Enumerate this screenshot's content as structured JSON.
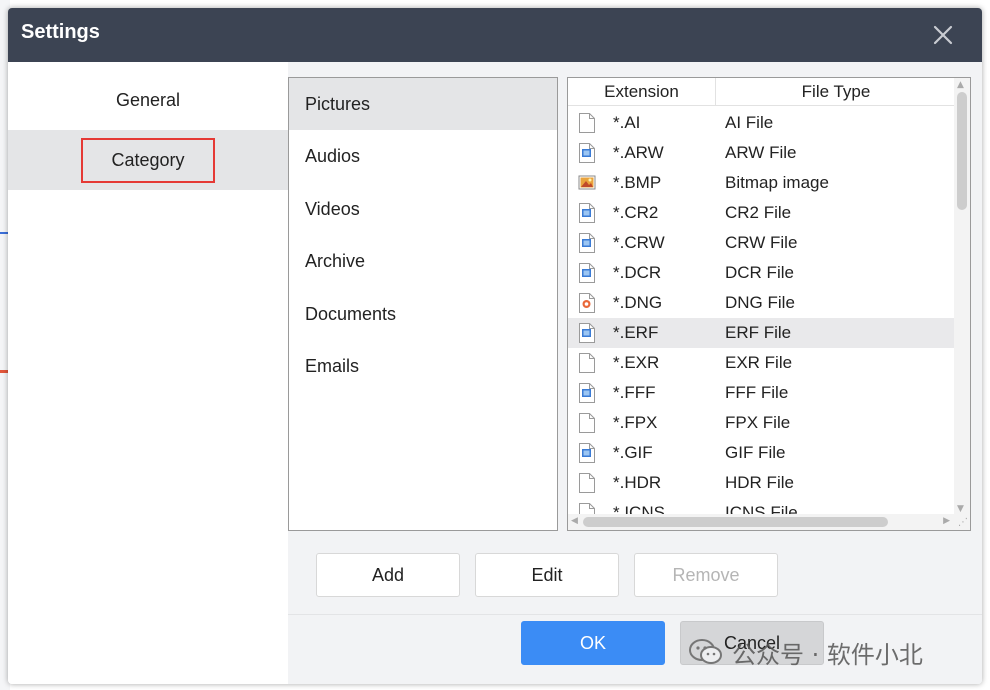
{
  "window": {
    "title": "Settings"
  },
  "nav": {
    "items": [
      {
        "label": "General"
      },
      {
        "label": "Category"
      }
    ],
    "selected": "Category"
  },
  "categories": {
    "items": [
      "Pictures",
      "Audios",
      "Videos",
      "Archive",
      "Documents",
      "Emails"
    ],
    "selected": "Pictures"
  },
  "extensions_table": {
    "headers": {
      "extension": "Extension",
      "file_type": "File Type"
    },
    "rows": [
      {
        "ext": "*.AI",
        "type": "AI File",
        "icon": "blank-file-icon"
      },
      {
        "ext": "*.ARW",
        "type": "ARW File",
        "icon": "image-file-icon"
      },
      {
        "ext": "*.BMP",
        "type": "Bitmap image",
        "icon": "bitmap-icon"
      },
      {
        "ext": "*.CR2",
        "type": "CR2 File",
        "icon": "image-file-icon"
      },
      {
        "ext": "*.CRW",
        "type": "CRW File",
        "icon": "image-file-icon"
      },
      {
        "ext": "*.DCR",
        "type": "DCR File",
        "icon": "image-file-icon"
      },
      {
        "ext": "*.DNG",
        "type": "DNG File",
        "icon": "dng-file-icon"
      },
      {
        "ext": "*.ERF",
        "type": "ERF File",
        "icon": "image-file-icon"
      },
      {
        "ext": "*.EXR",
        "type": "EXR File",
        "icon": "blank-file-icon"
      },
      {
        "ext": "*.FFF",
        "type": "FFF File",
        "icon": "image-file-icon"
      },
      {
        "ext": "*.FPX",
        "type": "FPX File",
        "icon": "blank-file-icon"
      },
      {
        "ext": "*.GIF",
        "type": "GIF File",
        "icon": "image-file-icon"
      },
      {
        "ext": "*.HDR",
        "type": "HDR File",
        "icon": "blank-file-icon"
      },
      {
        "ext": "*.ICNS",
        "type": "ICNS File",
        "icon": "blank-file-icon"
      }
    ],
    "selected_row": "*.ERF"
  },
  "buttons": {
    "add": "Add",
    "edit": "Edit",
    "remove": "Remove",
    "ok": "OK",
    "cancel": "Cancel"
  },
  "watermark": {
    "text": "公众号 · 软件小北"
  },
  "colors": {
    "titlebar": "#3c4453",
    "accent": "#3b8cf5",
    "highlight_box": "#e53935"
  }
}
